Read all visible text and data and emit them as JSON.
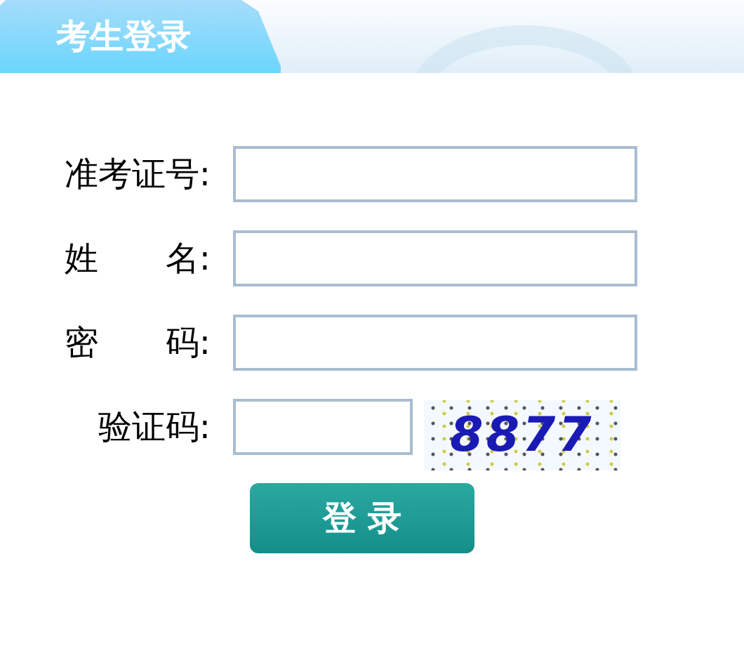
{
  "header": {
    "title": "考生登录"
  },
  "fields": [
    {
      "kind": "text",
      "label": "准考证号:"
    },
    {
      "kind": "text",
      "label": "姓　　名:"
    },
    {
      "kind": "password",
      "label": "密　　码:"
    },
    {
      "kind": "captcha",
      "label": "验证码:",
      "captcha": "8877"
    }
  ],
  "submit": {
    "label": "登 录"
  }
}
